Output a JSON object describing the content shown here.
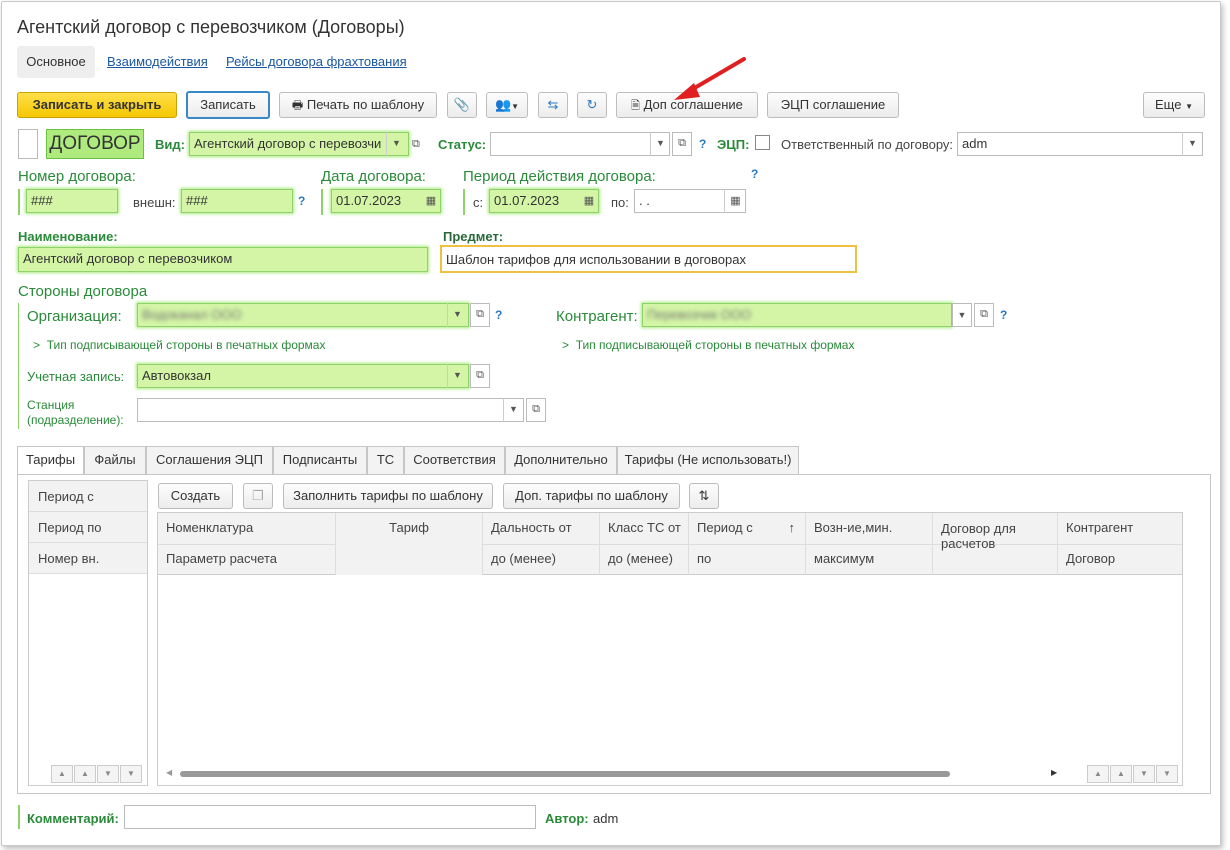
{
  "window_title": "Агентский договор с перевозчиком (Договоры)",
  "nav": {
    "main": "Основное",
    "interactions": "Взаимодействия",
    "trips": "Рейсы договора фрахтования"
  },
  "toolbar": {
    "save_close": "Записать и закрыть",
    "save": "Записать",
    "print_template": "Печать по шаблону",
    "dop": "Доп соглашение",
    "ecp": "ЭЦП соглашение",
    "more": "Еще"
  },
  "header": {
    "dogovor": "ДОГОВОР",
    "vid_label": "Вид:",
    "vid_value": "Агентский договор с перевозчи",
    "status_label": "Статус:",
    "status_value": "",
    "ecp_label": "ЭЦП:",
    "resp_label": "Ответственный по договору:",
    "resp_value": "adm",
    "q": "?"
  },
  "numbers": {
    "num_label": "Номер договора:",
    "num_value": "###",
    "ext_label": "внешн:",
    "ext_value": "###",
    "date_label": "Дата договора:",
    "date_value": "01.07.2023",
    "period_label": "Период действия договора:",
    "from_label": "с:",
    "from_value": "01.07.2023",
    "to_label": "по:",
    "to_value": " .  ."
  },
  "name": {
    "label": "Наименование:",
    "value": "Агентский договор с перевозчиком",
    "subject_label": "Предмет:",
    "subject_value": "Шаблон тарифов для использовании в договорах"
  },
  "parties": {
    "title": "Стороны договора",
    "org_label": "Организация:",
    "org_value": "Водоканал ООО",
    "contr_label": "Контрагент:",
    "contr_value": "Перевозчик ООО",
    "sign_type": "Тип подписывающей стороны в печатных формах",
    "account_label": "Учетная запись:",
    "account_value": "Автовокзал",
    "station_label": "Станция",
    "station_label2": "(подразделение):",
    "station_value": ""
  },
  "tabs": [
    "Тарифы",
    "Файлы",
    "Соглашения ЭЦП",
    "Подписанты",
    "ТС",
    "Соответствия",
    "Дополнительно",
    "Тарифы (Не использовать!)"
  ],
  "left_list": [
    "Период с",
    "Период по",
    "Номер вн."
  ],
  "table_toolbar": {
    "create": "Создать",
    "fill": "Заполнить тарифы по шаблону",
    "dop_tariffs": "Доп. тарифы по шаблону"
  },
  "columns": {
    "row1": [
      "Номенклатура",
      "Тариф",
      "Дальность от",
      "Класс ТС от",
      "Период  с",
      "Возн-ие,мин.",
      "Договор для расчетов",
      "Контрагент"
    ],
    "row2": [
      "Параметр расчета",
      "",
      "до (менее)",
      "до (менее)",
      "по",
      "максимум",
      "",
      "Договор"
    ]
  },
  "footer": {
    "comment_label": "Комментарий:",
    "comment_value": "",
    "author_label": "Автор:",
    "author_value": "adm"
  },
  "colors": {
    "accent_yellow": "#f5c800",
    "green": "#2a8a3a",
    "field_green": "#d4f5a6",
    "link": "#1a57a0",
    "arrow": "#e02020"
  }
}
